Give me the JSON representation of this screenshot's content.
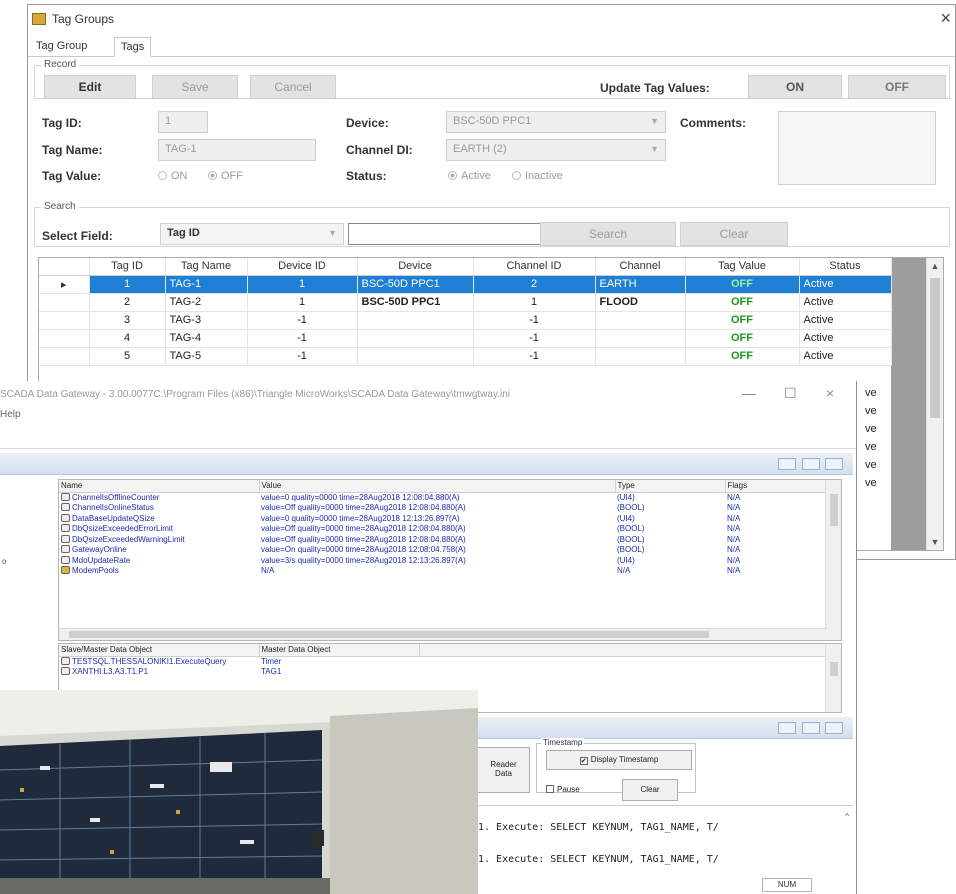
{
  "tag_window": {
    "title": "Tag Groups",
    "close_glyph": "×",
    "tabs": [
      "Tag Group",
      "Tags"
    ],
    "record": {
      "legend": "Record",
      "edit": "Edit",
      "save": "Save",
      "cancel": "Cancel",
      "update_label": "Update Tag Values:",
      "on": "ON",
      "off": "OFF"
    },
    "form": {
      "tag_id_label": "Tag ID:",
      "tag_id_value": "1",
      "tag_name_label": "Tag Name:",
      "tag_name_value": "TAG-1",
      "tag_value_label": "Tag Value:",
      "tag_value_on": "ON",
      "tag_value_off": "OFF",
      "device_label": "Device:",
      "device_value": "BSC-50D PPC1",
      "channel_label": "Channel DI:",
      "channel_value": "EARTH (2)",
      "status_label": "Status:",
      "status_active": "Active",
      "status_inactive": "Inactive",
      "comments_label": "Comments:"
    },
    "search": {
      "legend": "Search",
      "field_label": "Select Field:",
      "field_value": "Tag ID",
      "search_button": "Search",
      "clear_button": "Clear"
    },
    "grid": {
      "columns": [
        "Tag ID",
        "Tag Name",
        "Device ID",
        "Device",
        "Channel ID",
        "Channel",
        "Tag Value",
        "Status"
      ],
      "rows": [
        {
          "marker": "▸",
          "id": "1",
          "name": "TAG-1",
          "device_id": "1",
          "device": "BSC-50D PPC1",
          "channel_id": "2",
          "channel": "EARTH",
          "value": "OFF",
          "status": "Active"
        },
        {
          "marker": "",
          "id": "2",
          "name": "TAG-2",
          "device_id": "1",
          "device": "BSC-50D PPC1",
          "channel_id": "1",
          "channel": "FLOOD",
          "value": "OFF",
          "status": "Active"
        },
        {
          "marker": "",
          "id": "3",
          "name": "TAG-3",
          "device_id": "-1",
          "device": "",
          "channel_id": "-1",
          "channel": "",
          "value": "OFF",
          "status": "Active"
        },
        {
          "marker": "",
          "id": "4",
          "name": "TAG-4",
          "device_id": "-1",
          "device": "",
          "channel_id": "-1",
          "channel": "",
          "value": "OFF",
          "status": "Active"
        },
        {
          "marker": "",
          "id": "5",
          "name": "TAG-5",
          "device_id": "-1",
          "device": "",
          "channel_id": "-1",
          "channel": "",
          "value": "OFF",
          "status": "Active"
        }
      ],
      "hidden_status": [
        "ve",
        "ve",
        "ve",
        "ve",
        "ve",
        "ve"
      ]
    }
  },
  "gateway_window": {
    "title": "SCADA Data Gateway - 3.00.0077C:\\Program Files (x86)\\Triangle MicroWorks\\SCADA Data Gateway\\tmwgtway.ini",
    "menu": "Help",
    "minimize": "—",
    "maximize": "☐",
    "close": "×",
    "tree_stub": "o",
    "points_list": {
      "columns": [
        "Name",
        "Value",
        "Type",
        "Flags"
      ],
      "rows": [
        {
          "name": "ChannelIsOfflineCounter",
          "value": "value=0    quality=0000 time=28Aug2018 12:08:04.880(A)",
          "type": "(UI4)",
          "flags": "N/A"
        },
        {
          "name": "ChannelIsOnlineStatus",
          "value": "value=Off    quality=0000 time=28Aug2018 12:08:04.880(A)",
          "type": "(BOOL)",
          "flags": "N/A"
        },
        {
          "name": "DataBaseUpdateQSize",
          "value": "value=0    quality=0000 time=28Aug2018 12:13:26.897(A)",
          "type": "(UI4)",
          "flags": "N/A"
        },
        {
          "name": "DbQsizeExceededErrorLimit",
          "value": "value=Off    quality=0000 time=28Aug2018 12:08:04.880(A)",
          "type": "(BOOL)",
          "flags": "N/A"
        },
        {
          "name": "DbQsizeExceededWarningLimit",
          "value": "value=Off    quality=0000 time=28Aug2018 12:08:04.880(A)",
          "type": "(BOOL)",
          "flags": "N/A"
        },
        {
          "name": "GatewayOnline",
          "value": "value=On    quality=0000 time=28Aug2018 12:08:04.758(A)",
          "type": "(BOOL)",
          "flags": "N/A"
        },
        {
          "name": "MdoUpdateRate",
          "value": "value=3/s quality=0000 time=28Aug2018 12:13:26.897(A)",
          "type": "(UI4)",
          "flags": "N/A"
        },
        {
          "name": "ModemPools",
          "value": "N/A",
          "type": "N/A",
          "flags": "N/A"
        }
      ]
    },
    "mapping_list": {
      "columns": [
        "Slave/Master Data Object",
        "Master Data Object"
      ],
      "rows": [
        {
          "slave": "TESTSQL.THESSALONIKI1.ExecuteQuery",
          "master": "Timer"
        },
        {
          "slave": "XANTHI.L3.A3.T1.P1",
          "master": "TAG1"
        }
      ]
    },
    "log_pane": {
      "reader_label": "Reader",
      "data_label": "Data",
      "timestamp_legend": "Timestamp",
      "display_timestamp": "Display Timestamp",
      "pause": "Pause",
      "clear": "Clear",
      "lines": [
        "1. Execute: SELECT KEYNUM, TAG1_NAME, T/",
        "1. Execute: SELECT KEYNUM, TAG1_NAME, T/"
      ],
      "status_num": "NUM"
    }
  },
  "colors": {
    "selection_blue": "#1e7fd4",
    "tag_value_green": "#1a9a1a",
    "list_text_blue": "#1b2bb0"
  }
}
